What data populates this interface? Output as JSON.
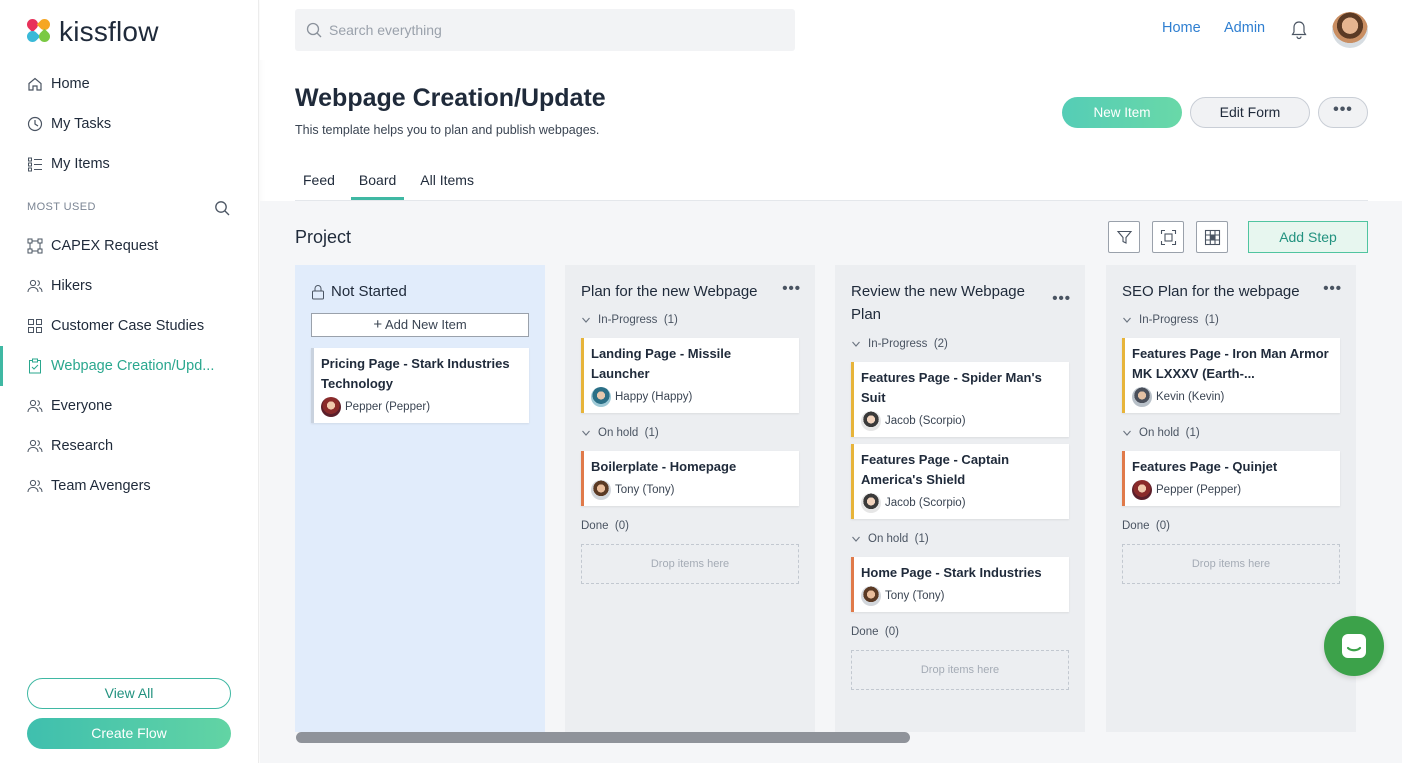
{
  "brand": {
    "name": "kissflow",
    "colors": [
      "#e8315a",
      "#f6a623",
      "#3ab9d8",
      "#7ac943"
    ]
  },
  "topbar": {
    "search_placeholder": "Search everything",
    "links": [
      "Home",
      "Admin"
    ]
  },
  "sidebar": {
    "items": [
      {
        "label": "Home",
        "icon": "home-icon"
      },
      {
        "label": "My Tasks",
        "icon": "clock-icon"
      },
      {
        "label": "My Items",
        "icon": "list-icon"
      }
    ],
    "section_label": "MOST USED",
    "most_used": [
      {
        "label": "CAPEX Request",
        "icon": "flow-icon"
      },
      {
        "label": "Hikers",
        "icon": "people-icon"
      },
      {
        "label": "Customer Case Studies",
        "icon": "grid-icon"
      },
      {
        "label": "Webpage Creation/Upd...",
        "icon": "clipboard-check-icon",
        "active": true
      },
      {
        "label": "Everyone",
        "icon": "people-icon"
      },
      {
        "label": "Research",
        "icon": "people-icon"
      },
      {
        "label": "Team Avengers",
        "icon": "people-icon"
      }
    ],
    "view_all": "View All",
    "create_flow": "Create Flow"
  },
  "header": {
    "title": "Webpage Creation/Update",
    "subtitle": "This template helps you to plan and publish webpages.",
    "new_item": "New Item",
    "edit_form": "Edit Form",
    "more": "•••",
    "tabs": [
      "Feed",
      "Board",
      "All Items"
    ],
    "active_tab": "Board"
  },
  "board": {
    "title": "Project",
    "add_step": "Add Step",
    "columns": [
      {
        "title": "Not Started",
        "add_item": "Add New Item",
        "cards": [
          {
            "title": "Pricing Page - Stark Industries Technology",
            "user": "Pepper (Pepper)"
          }
        ]
      },
      {
        "title": "Plan for the new Webpage",
        "groups": [
          {
            "label": "In-Progress",
            "count": "(1)",
            "cards": [
              {
                "title": "Landing Page - Missile Launcher",
                "user": "Happy (Happy)"
              }
            ]
          },
          {
            "label": "On hold",
            "count": "(1)",
            "cards": [
              {
                "title": "Boilerplate - Homepage",
                "user": "Tony (Tony)"
              }
            ]
          }
        ],
        "done": "Done",
        "done_count": "(0)",
        "drop": "Drop items here"
      },
      {
        "title": "Review the new Webpage Plan",
        "groups": [
          {
            "label": "In-Progress",
            "count": "(2)",
            "cards": [
              {
                "title": "Features Page - Spider Man's Suit",
                "user": "Jacob (Scorpio)"
              },
              {
                "title": "Features Page - Captain America's Shield",
                "user": "Jacob (Scorpio)"
              }
            ]
          },
          {
            "label": "On hold",
            "count": "(1)",
            "cards": [
              {
                "title": "Home Page - Stark Industries",
                "user": "Tony (Tony)"
              }
            ]
          }
        ],
        "done": "Done",
        "done_count": "(0)",
        "drop": "Drop items here"
      },
      {
        "title": "SEO Plan for the webpage",
        "groups": [
          {
            "label": "In-Progress",
            "count": "(1)",
            "cards": [
              {
                "title": "Features Page - Iron Man Armor MK LXXXV (Earth-...",
                "user": "Kevin (Kevin)"
              }
            ]
          },
          {
            "label": "On hold",
            "count": "(1)",
            "cards": [
              {
                "title": "Features Page - Quinjet",
                "user": "Pepper (Pepper)"
              }
            ]
          }
        ],
        "done": "Done",
        "done_count": "(0)",
        "drop": "Drop items here"
      }
    ]
  },
  "accent_colors": {
    "teal": "#3fb8a3",
    "link": "#2f7fd1",
    "in_progress": "#e7b43a",
    "on_hold": "#e07a4a",
    "chat": "#3ca24a"
  }
}
